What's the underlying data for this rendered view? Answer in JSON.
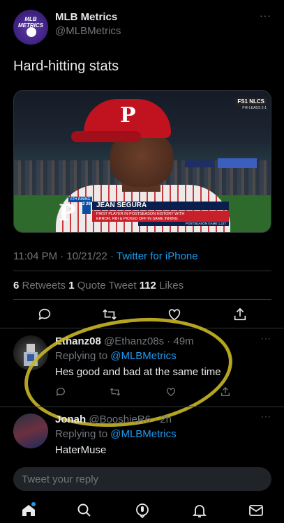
{
  "tweet": {
    "author_name": "MLB Metrics",
    "author_handle": "@MLBMetrics",
    "avatar_text": "MLB METRICS",
    "text": "Hard-hitting stats",
    "time": "11:04 PM · 10/21/22 · ",
    "source": "Twitter for iPhone",
    "retweets_count": "6",
    "retweets_label": " Retweets ",
    "quotes_count": "1",
    "quotes_label": " Quote Tweet ",
    "likes_count": "112",
    "likes_label": " Likes"
  },
  "media": {
    "network": "FS1 NLCS",
    "series_status": "PHI LEADS 2-1",
    "inning": "6TH INNING",
    "jersey_number": "2 29",
    "player_name": "JEAN SEGURA",
    "fact_line1": "FIRST PLAYER IN POSTSEASON HISTORY WITH",
    "fact_line2": "ERROR, RBI & PICKED OFF IN SAME INNING",
    "game_line": "POSTSEASON GAME 1,227",
    "cap_letter": "P"
  },
  "replies": [
    {
      "name": "Ethanz08",
      "handle_time": "@Ethanz08s · 49m",
      "replying_label": "Replying to ",
      "replying_to": "@MLBMetrics",
      "text": "Hes good and bad at the same time"
    },
    {
      "name": "Jonah",
      "handle_time": "@BooshieR6 · 2h",
      "replying_label": "Replying to ",
      "replying_to": "@MLBMetrics",
      "text": "HaterMuse"
    }
  ],
  "reply_box": {
    "placeholder": "Tweet your reply"
  },
  "colors": {
    "accent": "#1d9bf0",
    "annotation": "#c8b625",
    "background": "#000000"
  },
  "icons": [
    "more-icon",
    "reply-icon",
    "retweet-icon",
    "like-icon",
    "share-icon",
    "home-icon",
    "search-icon",
    "spaces-icon",
    "notifications-icon",
    "messages-icon"
  ]
}
